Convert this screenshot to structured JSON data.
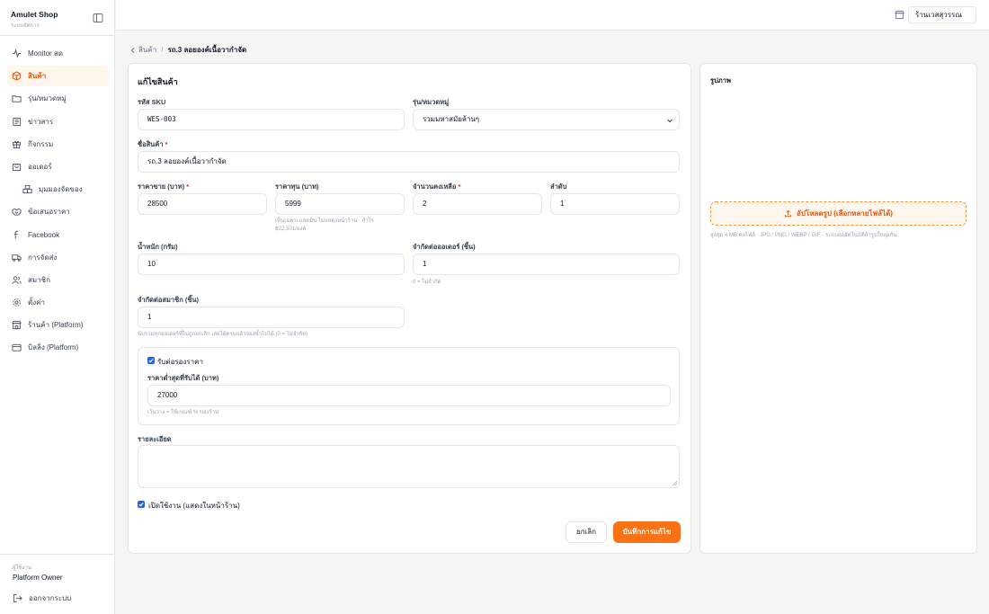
{
  "sidebar": {
    "brand": "Amulet Shop",
    "brand_sub": "ระบบจัดการ",
    "items": [
      {
        "label": "Monitor สด"
      },
      {
        "label": "สินค้า"
      },
      {
        "label": "รุ่น/หมวดหมู่"
      },
      {
        "label": "ข่าวสาร"
      },
      {
        "label": "กิจกรรม"
      },
      {
        "label": "ออเดอร์"
      },
      {
        "label": "มุมมองจัดของ"
      },
      {
        "label": "ข้อเสนอราคา"
      },
      {
        "label": "Facebook"
      },
      {
        "label": "การจัดส่ง"
      },
      {
        "label": "สมาชิก"
      },
      {
        "label": "ตั้งค่า"
      },
      {
        "label": "ร้านค้า (Platform)"
      },
      {
        "label": "บิลลิ่ง (Platform)"
      }
    ],
    "user_label": "ผู้ใช้งาน",
    "user_name": "Platform Owner",
    "logout": "ออกจากระบบ"
  },
  "header": {
    "store": "ร้านเวสสุวรรณ"
  },
  "breadcrumb": {
    "parent": "สินค้า",
    "sep": "/",
    "current": "รถ.3 ลอยองค์เนื้อวากำจัด"
  },
  "form": {
    "title": "แก้ไขสินค้า",
    "sku_label": "รหัส SKU",
    "sku_value": "WES-003",
    "category_label": "รุ่น/หมวดหมู่",
    "category_value": "รวมมหาสมัยล้านๆ",
    "name_label": "ชื่อสินค้า",
    "name_value": "รถ.3 ลอยองค์เนื้อวากำจัด",
    "price_label": "ราคาขาย (บาท)",
    "price_value": "28500",
    "cost_label": "ราคาทุน (บาท)",
    "cost_value": "5999",
    "cost_hint_1": "เห็นเฉพาะแอดมิน ไม่แสดงหน้าร้าน · กำไร",
    "cost_hint_2": "฿22,501/องค์",
    "stock_label": "จำนวนคงเหลือ",
    "stock_value": "2",
    "order_label": "ลำดับ",
    "order_value": "1",
    "weight_label": "น้ำหนัก (กรัม)",
    "weight_value": "10",
    "limit_order_label": "จำกัดต่อออเดอร์ (ชิ้น)",
    "limit_order_value": "1",
    "limit_order_hint": "0 = ไม่จำกัด",
    "limit_member_label": "จำกัดต่อสมาชิก (ชิ้น)",
    "limit_member_value": "1",
    "limit_member_hint": "นับรวมทุกออเดอร์ที่ไม่ถูกยกเลิก เลยได้ครบแล้วจองซ้ำไม่ได้ (0 = ไม่จำกัด)",
    "nego_label": "รับต่อรองราคา",
    "min_price_label": "ราคาต่ำสุดที่รับได้ (บาท)",
    "min_price_value": "27000",
    "min_price_hint": "เว้นว่าง = ใช้เกณฑ์ % ของร้าน",
    "detail_label": "รายละเอียด",
    "active_label": "เปิดใช้งาน (แสดงในหน้าร้าน)",
    "cancel": "ยกเลิก",
    "save": "บันทึกการแก้ไข"
  },
  "images": {
    "title": "รูปภาพ",
    "upload": "อัปโหลดรูป (เลือกหลายไฟล์ได้)",
    "hint": "สูงสุด 4 MB ต่อไฟล์ · JPG / PNG / WEBP / GIF · ระบบย่ออัตโนมัติถ้ารูปใหญ่เกิน"
  },
  "colors": {
    "accent": "#f97316",
    "accent_soft": "#fff7ed",
    "checkbox": "#2563eb"
  }
}
